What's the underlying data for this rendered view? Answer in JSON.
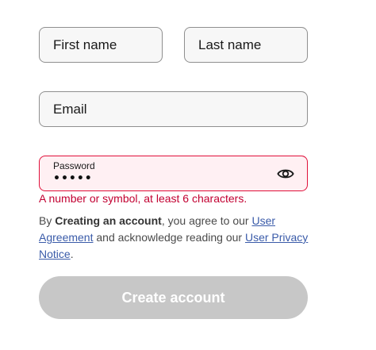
{
  "form": {
    "first_name_placeholder": "First name",
    "last_name_placeholder": "Last name",
    "email_placeholder": "Email",
    "password_label": "Password",
    "password_value": "•••••",
    "password_error": "A number or symbol, at least 6 characters.",
    "show_password_icon": "eye-icon"
  },
  "legal": {
    "prefix": "By ",
    "bold_text": "Creating an account",
    "middle1": ", you agree to our ",
    "link1": "User Agreement",
    "middle2": " and acknowledge reading our ",
    "link2": "User Privacy Notice",
    "suffix": "."
  },
  "actions": {
    "create_account_label": "Create account",
    "create_account_disabled": true
  },
  "colors": {
    "error": "#c20031",
    "error_bg": "#fff0f3",
    "link": "#3a5ba9",
    "button_disabled_bg": "#c7c7c7"
  }
}
